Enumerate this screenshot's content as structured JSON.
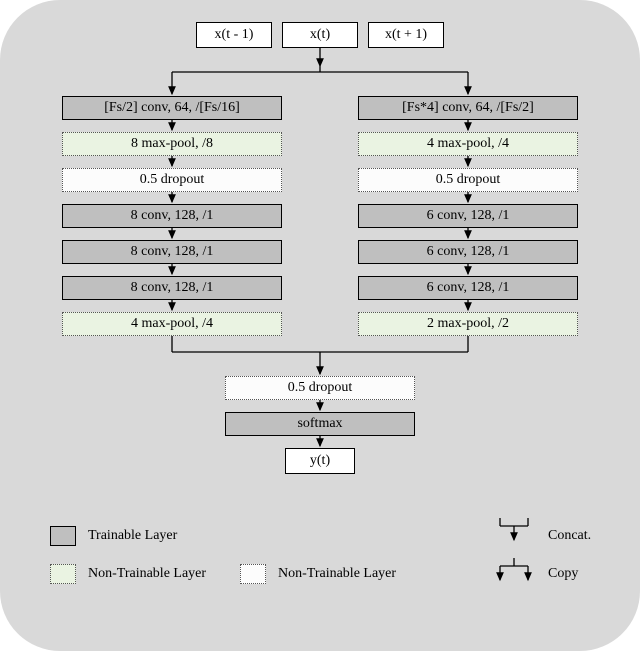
{
  "input": {
    "left": "x(t - 1)",
    "mid": "x(t)",
    "right": "x(t + 1)"
  },
  "left": {
    "b1": "[Fs/2] conv, 64, /[Fs/16]",
    "b2": "8 max-pool, /8",
    "b3": "0.5 dropout",
    "b4": "8 conv, 128, /1",
    "b5": "8 conv, 128, /1",
    "b6": "8 conv, 128, /1",
    "b7": "4 max-pool, /4"
  },
  "right": {
    "b1": "[Fs*4] conv, 64, /[Fs/2]",
    "b2": "4 max-pool, /4",
    "b3": "0.5 dropout",
    "b4": "6 conv, 128, /1",
    "b5": "6 conv, 128, /1",
    "b6": "6 conv, 128, /1",
    "b7": "2 max-pool, /2"
  },
  "shared": {
    "dropout": "0.5 dropout",
    "softmax": "softmax",
    "out": "y(t)"
  },
  "legend": {
    "trainable": "Trainable Layer",
    "nontrainable_fill": "Non-Trainable Layer",
    "nontrainable_plain": "Non-Trainable Layer",
    "concat": "Concat.",
    "copy": "Copy"
  }
}
